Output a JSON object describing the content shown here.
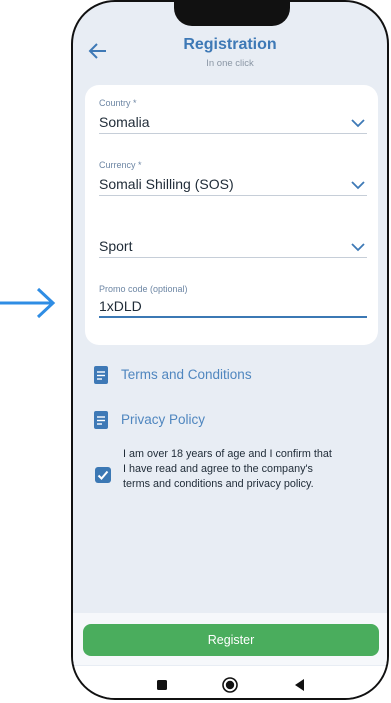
{
  "header": {
    "title": "Registration",
    "subtitle": "In one click"
  },
  "form": {
    "country": {
      "label": "Country *",
      "value": "Somalia"
    },
    "currency": {
      "label": "Currency *",
      "value": "Somali Shilling (SOS)"
    },
    "sport": {
      "value": "Sport"
    },
    "promo": {
      "label": "Promo code (optional)",
      "value": "1xDLD"
    }
  },
  "links": {
    "terms": "Terms and Conditions",
    "privacy": "Privacy Policy"
  },
  "agreement": {
    "checked": true,
    "text": "I am over 18 years of age and I confirm that I have read and agree to the company's terms and conditions and privacy policy."
  },
  "actions": {
    "register_label": "Register"
  },
  "colors": {
    "accent": "#3e79b6",
    "register": "#4aad5d",
    "background": "#e8edf4",
    "external_arrow": "#2f8de4"
  },
  "icons": [
    "arrow-right-icon",
    "back-arrow-icon",
    "chevron-down-icon",
    "document-icon",
    "checkmark-icon",
    "square-icon",
    "circle-icon",
    "triangle-back-icon"
  ]
}
